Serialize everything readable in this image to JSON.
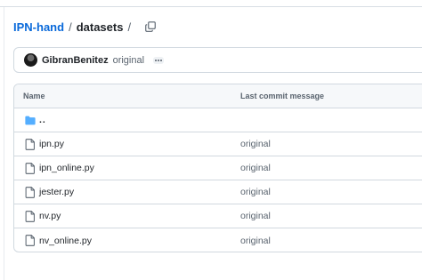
{
  "breadcrumb": {
    "repo": "IPN-hand",
    "separator": "/",
    "folder": "datasets",
    "trailing": "/"
  },
  "commit": {
    "author": "GibranBenitez",
    "message": "original"
  },
  "table": {
    "headers": {
      "name": "Name",
      "message": "Last commit message"
    },
    "parent_row": {
      "name": "..",
      "icon": "folder-icon"
    },
    "rows": [
      {
        "name": "ipn.py",
        "message": "original",
        "icon": "file-icon"
      },
      {
        "name": "ipn_online.py",
        "message": "original",
        "icon": "file-icon"
      },
      {
        "name": "jester.py",
        "message": "original",
        "icon": "file-icon"
      },
      {
        "name": "nv.py",
        "message": "original",
        "icon": "file-icon"
      },
      {
        "name": "nv_online.py",
        "message": "original",
        "icon": "file-icon"
      }
    ]
  },
  "colors": {
    "link": "#0969da",
    "folder": "#54aeff",
    "text": "#1f2328",
    "muted": "#59636e",
    "border": "#d1d9e0"
  }
}
